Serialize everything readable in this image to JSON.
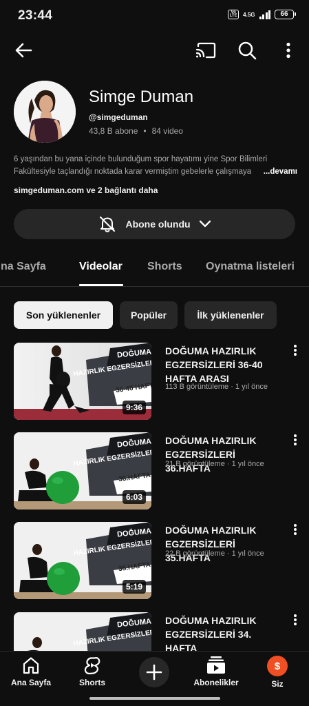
{
  "status_bar": {
    "time": "23:44",
    "volte": "Vo LTE",
    "network": "4.5G",
    "battery": "66"
  },
  "top_bar": {
    "icons": [
      "back-arrow-icon",
      "cast-icon",
      "search-icon",
      "more-vert-icon"
    ]
  },
  "channel": {
    "name": "Simge Duman",
    "handle": "@simgeduman",
    "subscribers": "43,8 B abone",
    "separator": "•",
    "video_count": "84 video",
    "description_line1": "6 yaşından bu yana içinde bulunduğum spor hayatımı yine Spor  Bilimleri",
    "description_line2": "Fakültesiyle taçlandığı noktada karar vermiştim gebelerle çalışmaya",
    "description_more": "...devamı",
    "links": "simgeduman.com ve 2 bağlantı daha",
    "subscribe_label": "Abone olundu"
  },
  "tabs": [
    {
      "label": "na Sayfa"
    },
    {
      "label": "Videolar"
    },
    {
      "label": "Shorts"
    },
    {
      "label": "Oynatma listeleri"
    }
  ],
  "chips": [
    {
      "label": "Son yüklenenler"
    },
    {
      "label": "Popüler"
    },
    {
      "label": "İlk yüklenenler"
    }
  ],
  "videos": [
    {
      "title": "DOĞUMA HAZIRLIK EGZERSİZLERİ 36-40 HAFTA ARASI",
      "meta": "113 B görüntüleme · 1 yıl önce",
      "duration": "9:36",
      "thumb_line1": "DOĞUMA",
      "thumb_line2": "HAZIRLIK EGZERSİZLERİ",
      "thumb_line3": "36-40 HAFTA"
    },
    {
      "title": "DOĞUMA HAZIRLIK EGZERSİZLERİ 36.HAFTA",
      "meta": "21 B görüntüleme · 1 yıl önce",
      "duration": "6:03",
      "thumb_line1": "DOĞUMA",
      "thumb_line2": "HAZIRLIK EGZERSİZLERİ",
      "thumb_line3": "36.HAFTA"
    },
    {
      "title": "DOĞUMA HAZIRLIK EGZERSİZLERİ 35.HAFTA",
      "meta": "22 B görüntüleme · 1 yıl önce",
      "duration": "5:19",
      "thumb_line1": "DOĞUMA",
      "thumb_line2": "HAZIRLIK EGZERSİZLERİ",
      "thumb_line3": "35.HAFTA"
    },
    {
      "title": "DOĞUMA HAZIRLIK EGZERSİZLERİ 34. HAFTA",
      "meta": "",
      "duration": "",
      "thumb_line1": "DOĞUMA",
      "thumb_line2": "HAZIRLIK EGZERSİZLERİ",
      "thumb_line3": ""
    }
  ],
  "bottom_nav": [
    {
      "label": "Ana Sayfa",
      "icon": "home-icon"
    },
    {
      "label": "Shorts",
      "icon": "shorts-icon"
    },
    {
      "label": "",
      "icon": "create-icon"
    },
    {
      "label": "Abonelikler",
      "icon": "subscriptions-icon"
    },
    {
      "label": "Siz",
      "icon": "you-avatar"
    }
  ],
  "colors": {
    "background": "#0f0f0f",
    "surface": "#272727",
    "text": "#f1f1f1",
    "secondary_text": "#aaaaaa",
    "chip_selected": "#f1f1f1",
    "you_avatar": "#f04e23"
  }
}
